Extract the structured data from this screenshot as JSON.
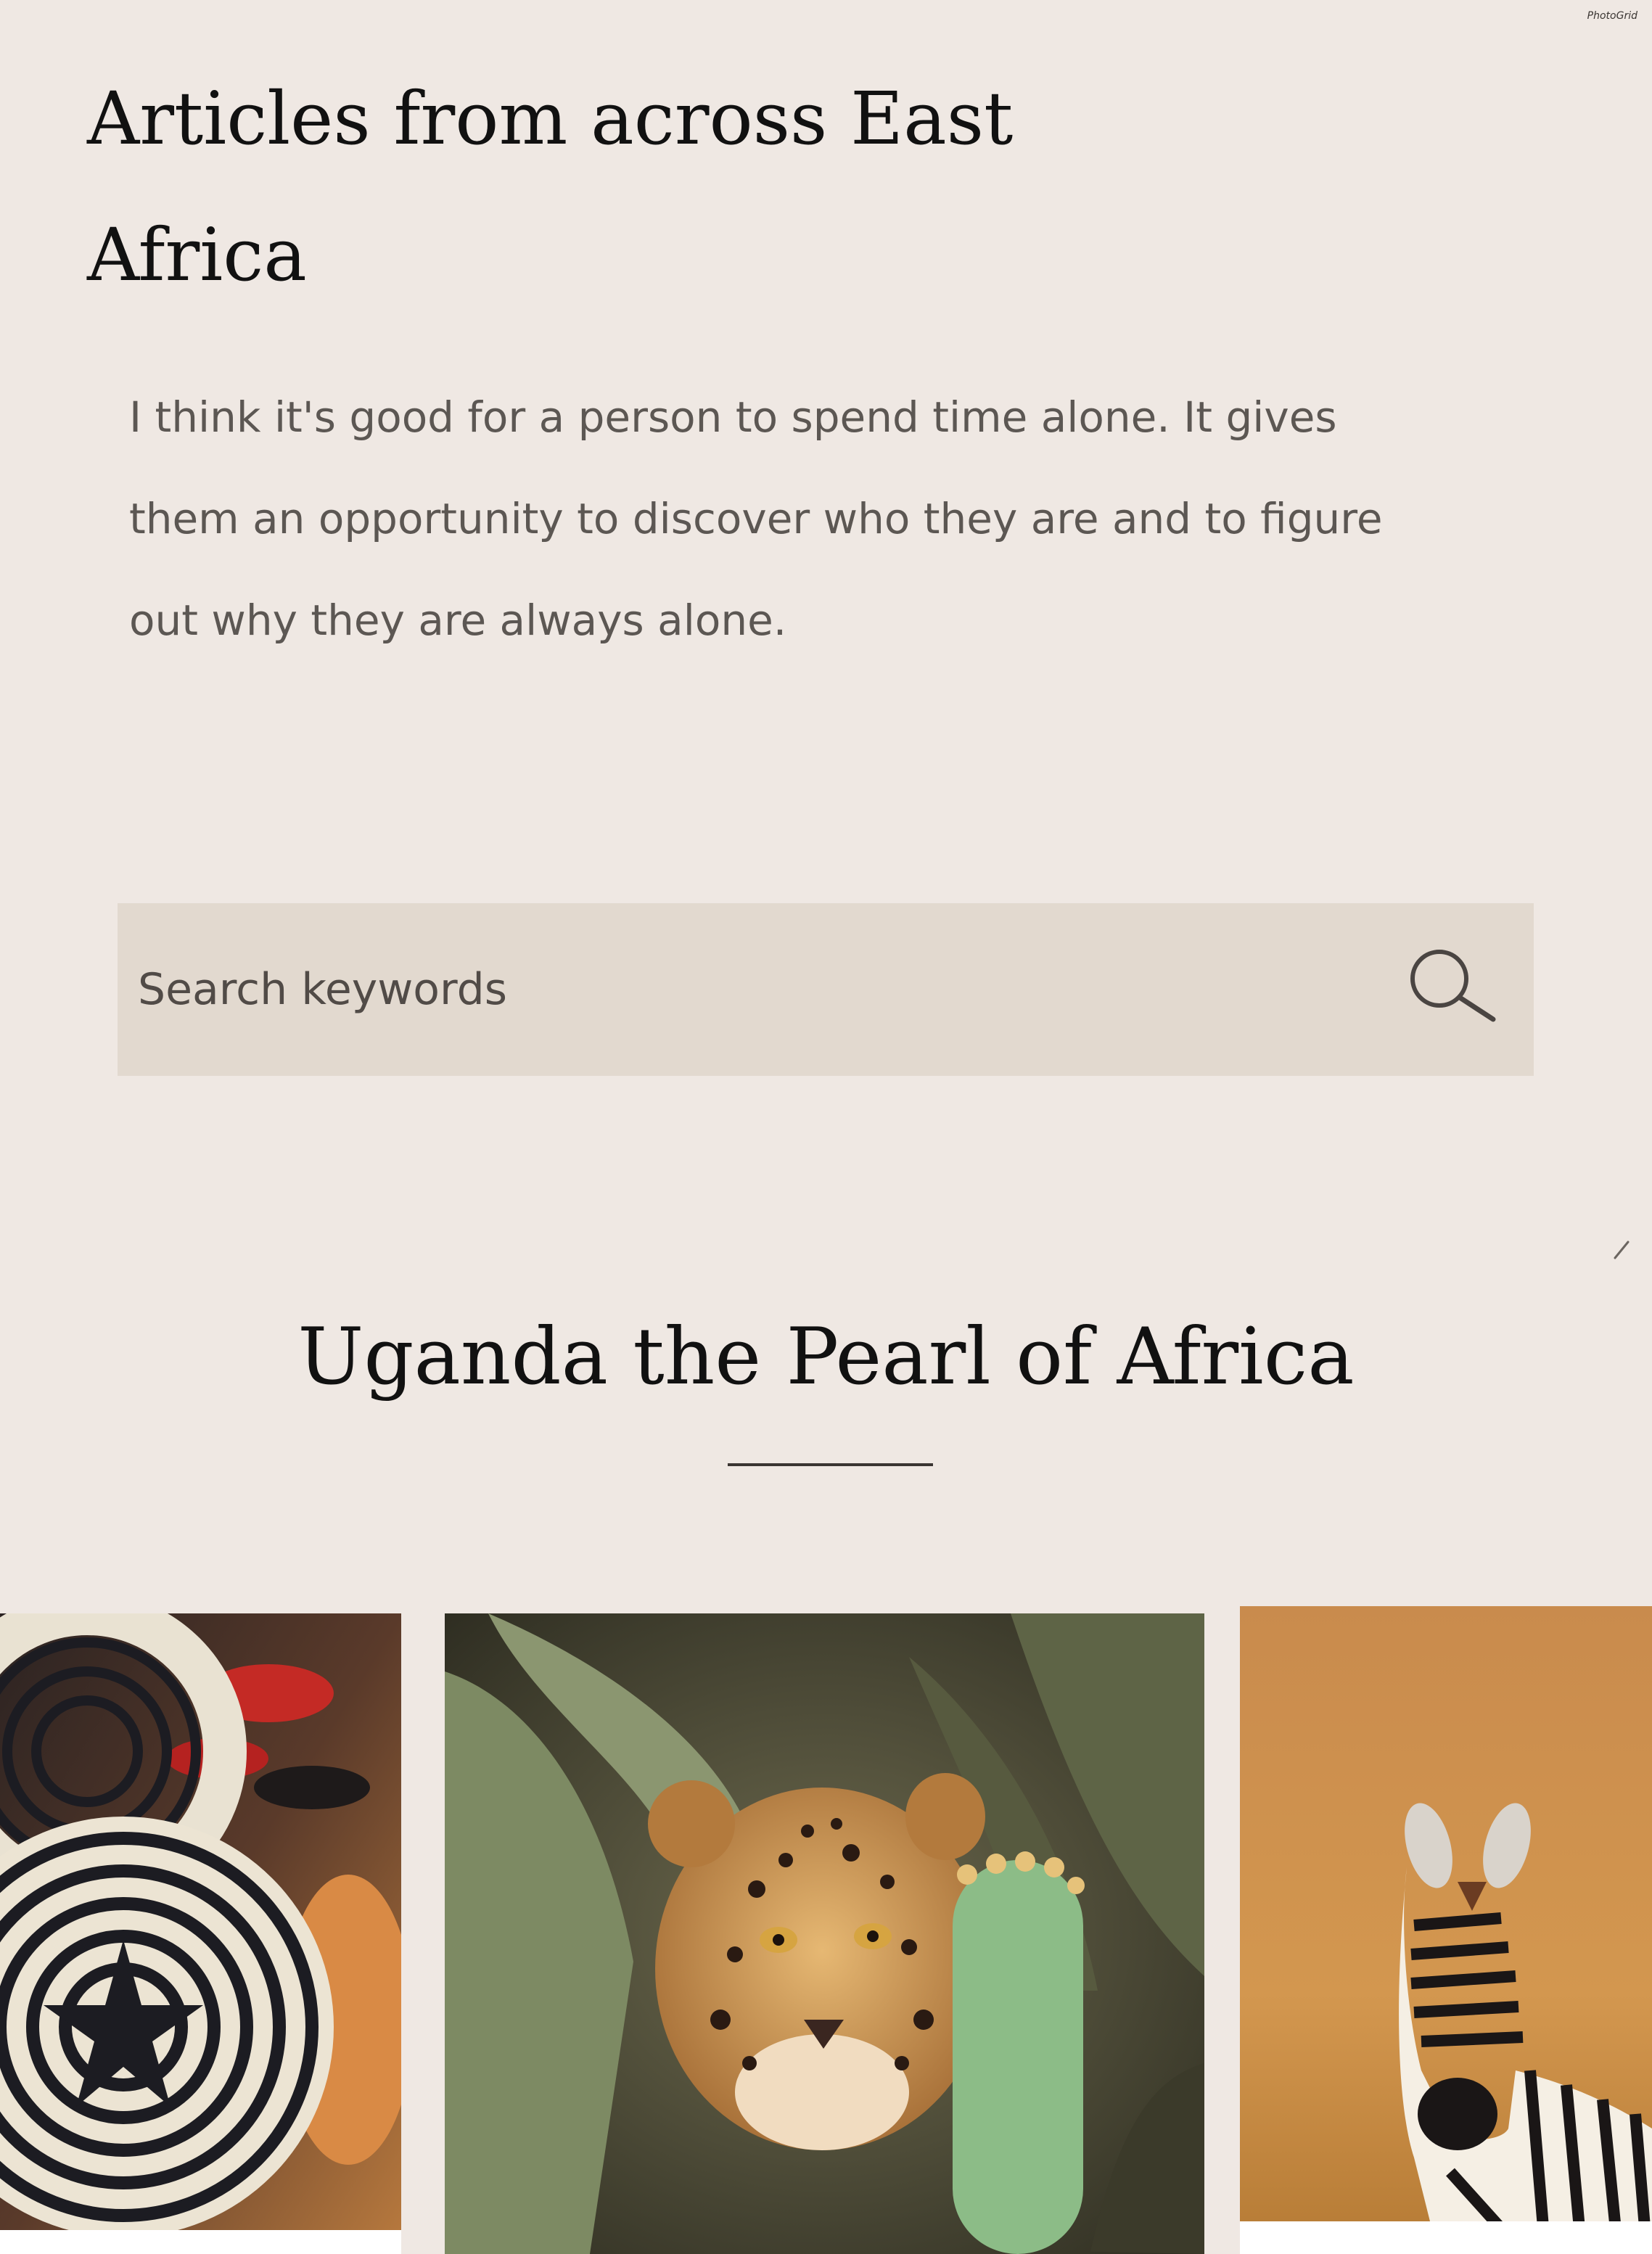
{
  "watermark": "PhotoGrid",
  "header": {
    "title_line1": "Articles from across East",
    "title_line2": "Africa",
    "intro_line1": "I think it's good for a person to spend time alone. It gives",
    "intro_line2": "them an opportunity to discover who they are and to figure",
    "intro_line3": "out why they are always alone."
  },
  "search": {
    "placeholder": "Search keywords",
    "value": "",
    "icon": "search-icon"
  },
  "section": {
    "title": "Uganda the Pearl of Africa"
  },
  "gallery": {
    "items": [
      {
        "name": "woven-baskets-photo"
      },
      {
        "name": "leopard-photo"
      },
      {
        "name": "zebra-photo"
      }
    ]
  },
  "colors": {
    "background": "#efe8e3",
    "search_bg": "#e2d9cf",
    "heading_text": "#111111",
    "body_text": "#5c5753"
  }
}
